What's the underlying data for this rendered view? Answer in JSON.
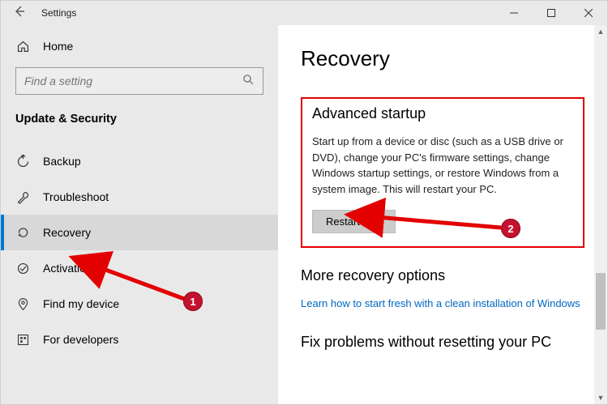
{
  "window": {
    "title": "Settings"
  },
  "sidebar": {
    "home_label": "Home",
    "search_placeholder": "Find a setting",
    "category": "Update & Security",
    "items": [
      {
        "label": "Backup",
        "icon": "backup"
      },
      {
        "label": "Troubleshoot",
        "icon": "troubleshoot"
      },
      {
        "label": "Recovery",
        "icon": "recovery",
        "selected": true
      },
      {
        "label": "Activation",
        "icon": "activation"
      },
      {
        "label": "Find my device",
        "icon": "find-device"
      },
      {
        "label": "For developers",
        "icon": "developers"
      }
    ]
  },
  "page": {
    "title": "Recovery",
    "adv": {
      "heading": "Advanced startup",
      "body": "Start up from a device or disc (such as a USB drive or DVD), change your PC's firmware settings, change Windows startup settings, or restore Windows from a system image. This will restart your PC.",
      "button": "Restart now"
    },
    "more": {
      "heading": "More recovery options",
      "link": "Learn how to start fresh with a clean installation of Windows"
    },
    "fix": {
      "heading": "Fix problems without resetting your PC"
    }
  },
  "annotations": {
    "marker1": "1",
    "marker2": "2"
  }
}
